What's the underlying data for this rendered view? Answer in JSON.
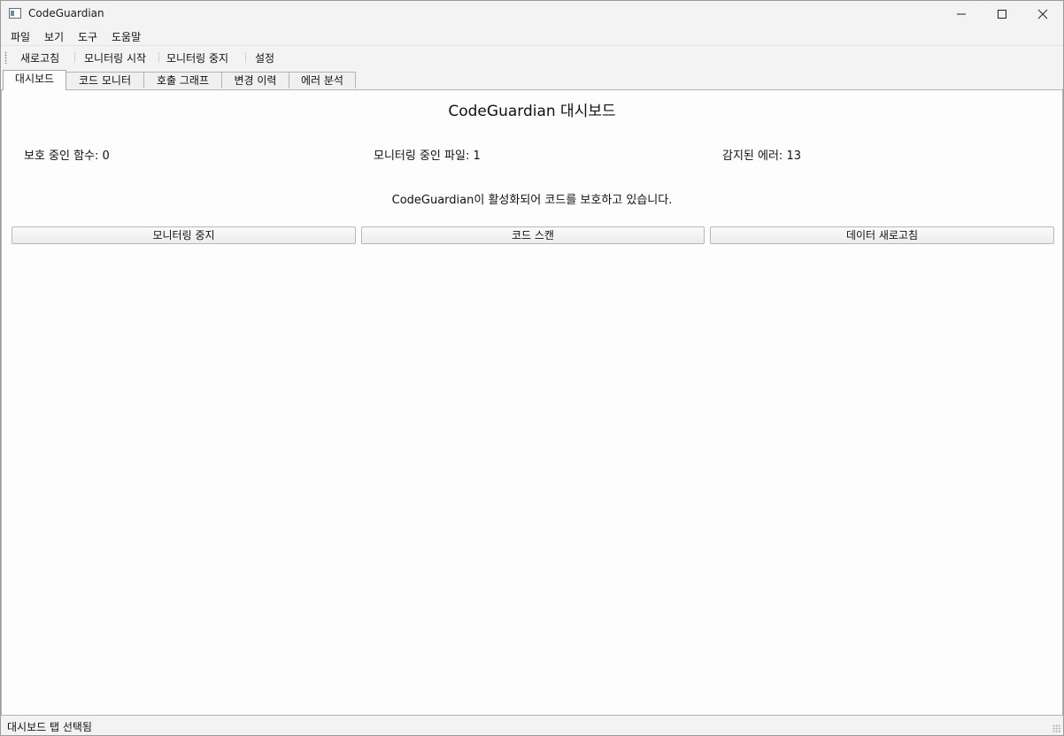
{
  "window": {
    "title": "CodeGuardian"
  },
  "menubar": {
    "items": [
      {
        "label": "파일"
      },
      {
        "label": "보기"
      },
      {
        "label": "도구"
      },
      {
        "label": "도움말"
      }
    ]
  },
  "toolbar": {
    "items": [
      {
        "label": "새로고침"
      },
      {
        "label": "모니터링 시작"
      },
      {
        "label": "모니터링 중지"
      },
      {
        "label": "설정"
      }
    ]
  },
  "tabs": [
    {
      "label": "대시보드",
      "active": true
    },
    {
      "label": "코드 모니터",
      "active": false
    },
    {
      "label": "호출 그래프",
      "active": false
    },
    {
      "label": "변경 이력",
      "active": false
    },
    {
      "label": "에러 분석",
      "active": false
    }
  ],
  "dashboard": {
    "title": "CodeGuardian 대시보드",
    "stats": [
      {
        "text": "보호 중인 함수: 0"
      },
      {
        "text": "모니터링 중인 파일: 1"
      },
      {
        "text": "감지된 에러: 13"
      }
    ],
    "status_message": "CodeGuardian이 활성화되어 코드를 보호하고 있습니다.",
    "buttons": [
      {
        "label": "모니터링 중지"
      },
      {
        "label": "코드 스캔"
      },
      {
        "label": "데이터 새로고침"
      }
    ]
  },
  "statusbar": {
    "text": "대시보드 탭 선택됨"
  },
  "icons": {
    "app": "app-window-icon",
    "minimize": "minimize-icon",
    "maximize": "maximize-icon",
    "close": "close-icon"
  }
}
